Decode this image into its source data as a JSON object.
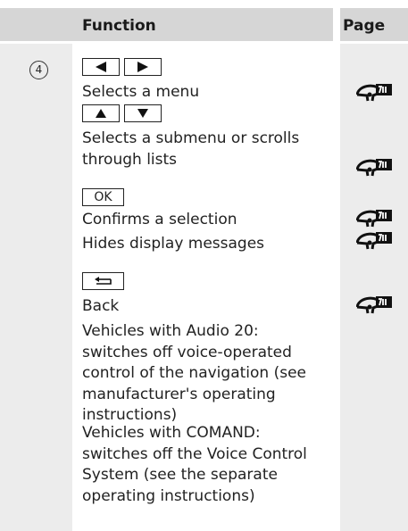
{
  "header": {
    "function_label": "Function",
    "page_label": "Page"
  },
  "item_number": "4",
  "keys": {
    "ok_label": "OK"
  },
  "rows": {
    "selects_menu": "Selects a menu",
    "selects_submenu": "Selects a submenu or scrolls through lists",
    "confirms": "Confirms a selection",
    "hides": "Hides display messages",
    "back": "Back",
    "audio20": "Vehicles with Audio 20: switches off voice-operated control of the navigation (see manufacturer's operating instructions)",
    "comand": "Vehicles with COMAND: switches off the Voice Control System (see the separate operating instructions)"
  },
  "icons": {
    "page_reference": "steering-wheel-page-icon",
    "left_key": "triangle-left-icon",
    "right_key": "triangle-right-icon",
    "up_key": "triangle-up-icon",
    "down_key": "triangle-down-icon",
    "back_key": "back-arrow-icon"
  },
  "colors": {
    "header_bg": "#d6d6d6",
    "column_bg": "#ececec"
  }
}
